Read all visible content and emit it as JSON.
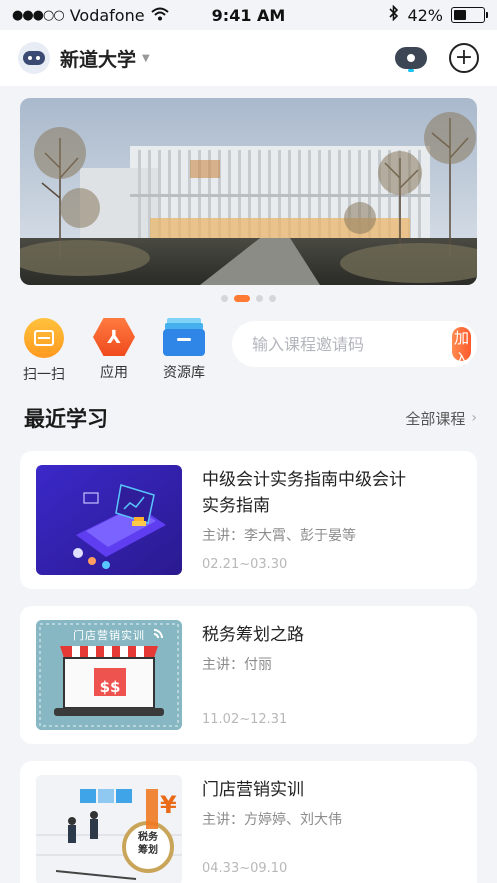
{
  "status_bar": {
    "signal": "●●●○○",
    "carrier": "Vodafone",
    "time": "9:41 AM",
    "battery_text": "42%",
    "battery_level": 0.42
  },
  "header": {
    "school_name": "新道大学",
    "dropdown_caret": "▼",
    "add_symbol": "+"
  },
  "banner": {
    "slide_count": 4,
    "active_index": 1
  },
  "quick_actions": [
    {
      "label": "扫一扫",
      "icon": "scan-icon"
    },
    {
      "label": "应用",
      "icon": "apps-icon"
    },
    {
      "label": "资源库",
      "icon": "resource-library-icon"
    }
  ],
  "invite": {
    "placeholder": "输入课程邀请码",
    "button_label": "加入"
  },
  "recent": {
    "title": "最近学习",
    "more_label": "全部课程",
    "more_chevron": "›",
    "courses": [
      {
        "title": "中级会计实务指南中级会计实务指南",
        "teacher": "主讲：李大霄、彭于晏等",
        "dates": "02.21~03.30"
      },
      {
        "title": "税务筹划之路",
        "teacher": "主讲：付丽",
        "dates": "11.02~12.31",
        "thumb_caption": "门店营销实训",
        "thumb_sign": "$$"
      },
      {
        "title": "门店营销实训",
        "teacher": "主讲：方婷婷、刘大伟",
        "dates": "04.33~09.10",
        "thumb_caption": "税务\n筹划",
        "thumb_symbol": "¥"
      }
    ]
  },
  "colors": {
    "accent": "#ff6a36",
    "background": "#f3f4f8"
  }
}
